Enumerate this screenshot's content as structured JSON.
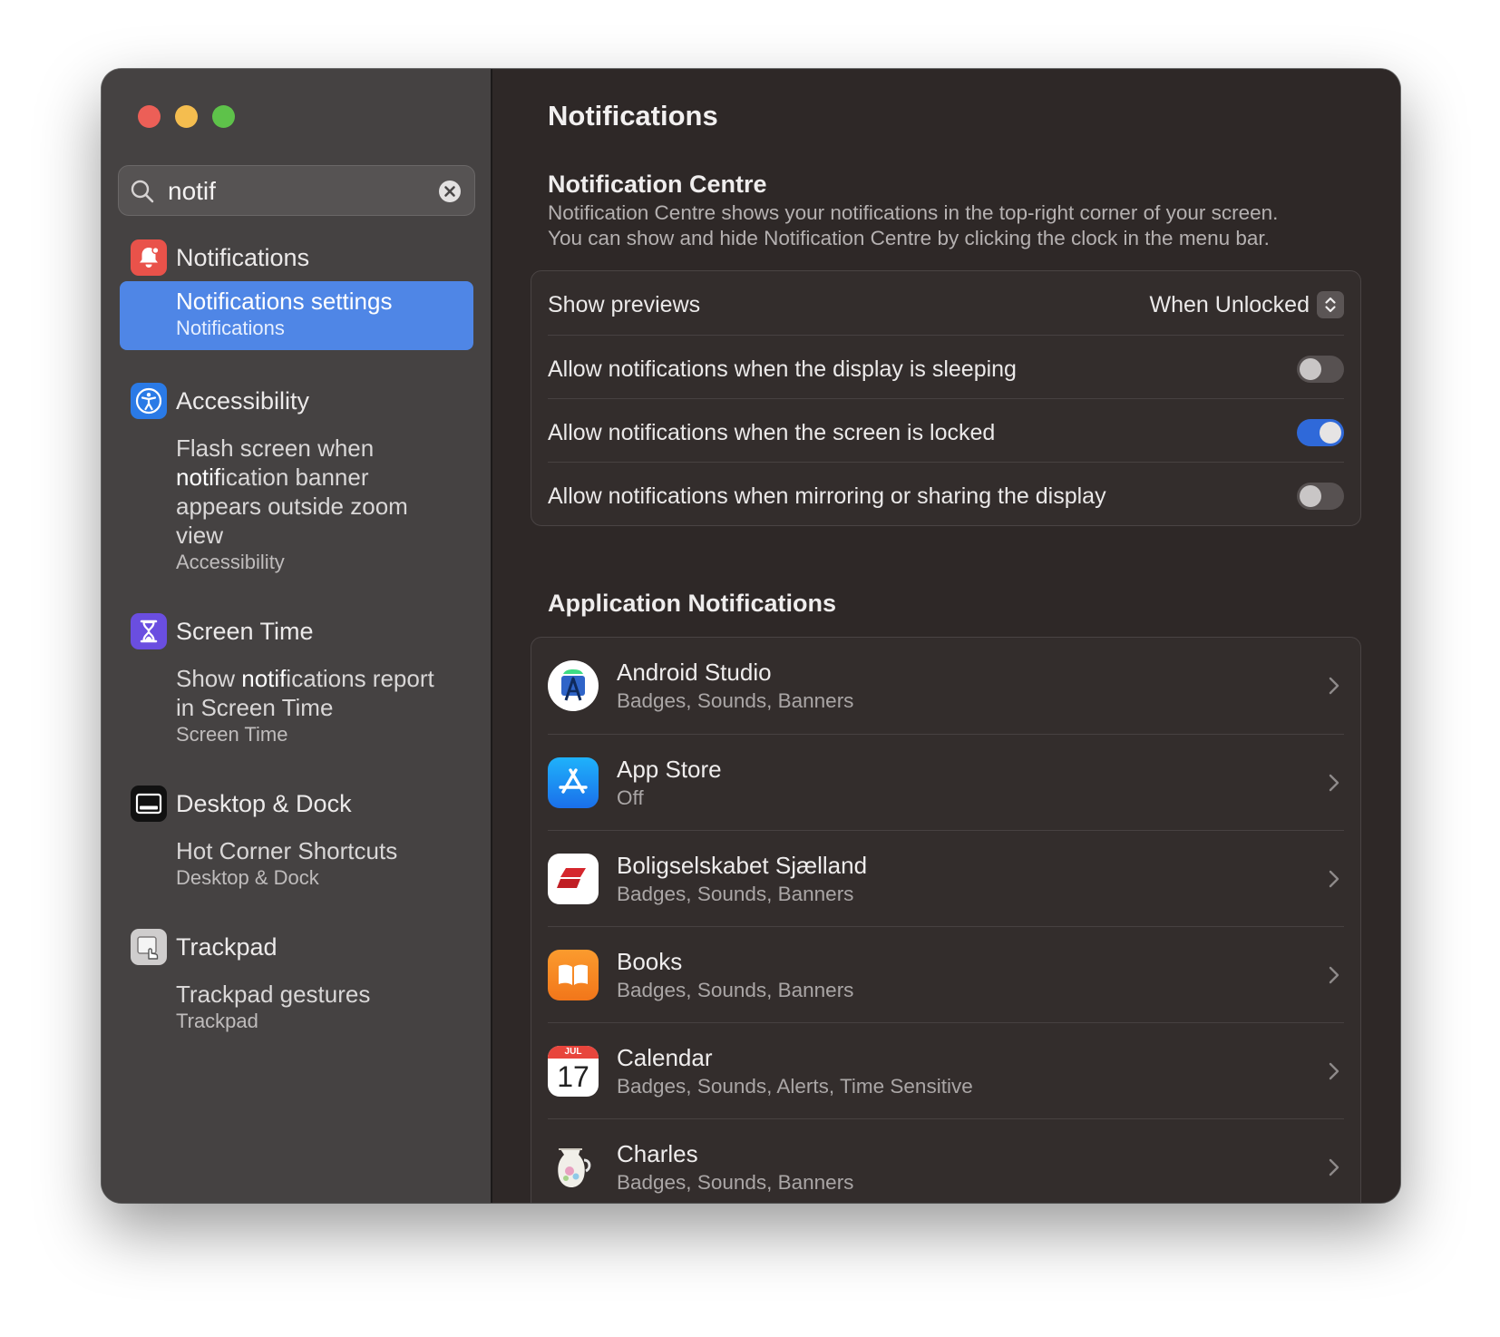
{
  "window": {
    "sidebar": {
      "search": {
        "value": "notif"
      },
      "groups": [
        {
          "name": "Notifications",
          "icon": "bell-icon",
          "results": [
            {
              "pre": "",
              "match": "Notif",
              "post": "ications settings",
              "sub": "Notifications",
              "selected": true
            }
          ]
        },
        {
          "name": "Accessibility",
          "icon": "accessibility-icon",
          "results": [
            {
              "line1": "Flash screen when",
              "match": "notif",
              "post": "ication banner",
              "line3": "appears outside zoom",
              "line4": "view",
              "sub": "Accessibility"
            }
          ]
        },
        {
          "name": "Screen Time",
          "icon": "hourglass-icon",
          "results": [
            {
              "pre": "Show ",
              "match": "notif",
              "post": "ications report",
              "line2": "in Screen Time",
              "sub": "Screen Time"
            }
          ]
        },
        {
          "name": "Desktop & Dock",
          "icon": "desktop-dock-icon",
          "results": [
            {
              "title": "Hot Corner Shortcuts",
              "sub": "Desktop & Dock"
            }
          ]
        },
        {
          "name": "Trackpad",
          "icon": "trackpad-icon",
          "results": [
            {
              "title": "Trackpad gestures",
              "sub": "Trackpad"
            }
          ]
        }
      ]
    },
    "main": {
      "title": "Notifications",
      "notification_centre": {
        "heading": "Notification Centre",
        "description_line1": "Notification Centre shows your notifications in the top-right corner of your screen.",
        "description_line2": "You can show and hide Notification Centre by clicking the clock in the menu bar.",
        "show_previews": {
          "label": "Show previews",
          "value": "When Unlocked"
        },
        "toggles": [
          {
            "label": "Allow notifications when the display is sleeping",
            "on": false
          },
          {
            "label": "Allow notifications when the screen is locked",
            "on": true
          },
          {
            "label": "Allow notifications when mirroring or sharing the display",
            "on": false
          }
        ]
      },
      "application_notifications": {
        "heading": "Application Notifications",
        "apps": [
          {
            "name": "Android Studio",
            "detail": "Badges, Sounds, Banners",
            "icon": "android-studio-icon"
          },
          {
            "name": "App Store",
            "detail": "Off",
            "icon": "app-store-icon"
          },
          {
            "name": "Boligselskabet Sjælland",
            "detail": "Badges, Sounds, Banners",
            "icon": "boligselskabet-icon"
          },
          {
            "name": "Books",
            "detail": "Badges, Sounds, Banners",
            "icon": "books-icon"
          },
          {
            "name": "Calendar",
            "detail": "Badges, Sounds, Alerts, Time Sensitive",
            "icon": "calendar-icon",
            "icon_month": "JUL",
            "icon_day": "17"
          },
          {
            "name": "Charles",
            "detail": "Badges, Sounds, Banners",
            "icon": "charles-icon"
          }
        ]
      }
    }
  }
}
